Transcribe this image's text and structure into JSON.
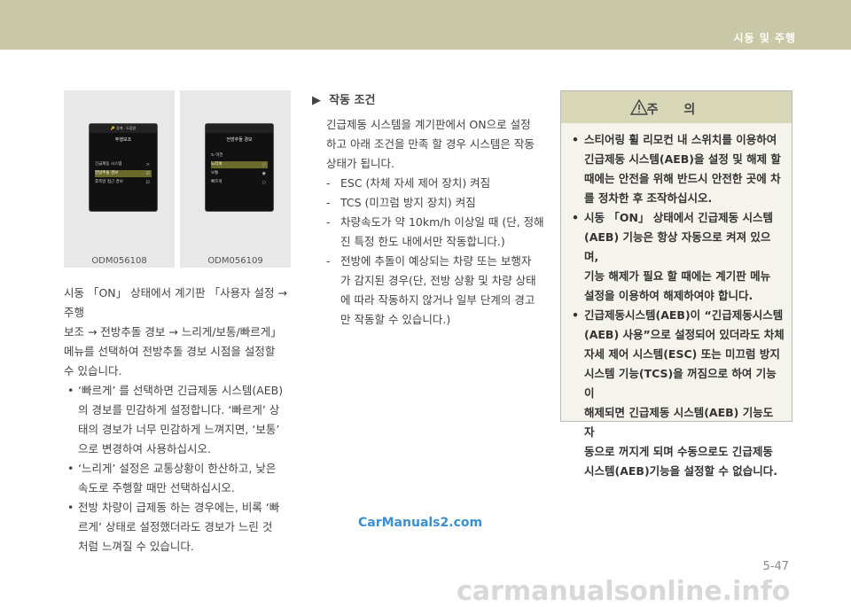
{
  "header": {
    "title": "시동 및 주행"
  },
  "page_number": "5-47",
  "images": [
    {
      "caption": "ODM056108",
      "screen_top": "🔑 경계 · 도움말",
      "screen_title": "주행보조",
      "rows": [
        "긴급제동 시스템",
        "전방추돌 경보",
        "후측방 접근 경보"
      ],
      "marks": [
        ">",
        "☑",
        "☑"
      ]
    },
    {
      "caption": "ODM056109",
      "screen_top": "",
      "screen_title": "전방추돌 경보",
      "rows": [
        "↻ 이전",
        "느리게",
        "보통",
        "빠르게"
      ],
      "marks": [
        "",
        "○",
        "◉",
        "○"
      ]
    }
  ],
  "left_text": {
    "intro": [
      "시동 「ON」 상태에서 계기판 「사용자 설정 →주행",
      "보조 → 전방추돌 경보 → 느리게/보통/빠르게」",
      "메뉴를 선택하여 전방추돌 경보 시점을 설정할",
      "수 있습니다."
    ],
    "bullets": [
      [
        "‘빠르게’ 를 선택하면 긴급제동 시스템(AEB)",
        "의 경보를 민감하게 설정합니다. ‘빠르게’ 상",
        "태의 경보가 너무 민감하게 느껴지면, ‘보통’",
        "으로 변경하여 사용하십시오."
      ],
      [
        "‘느리게’ 설정은 교통상황이 한산하고, 낮은",
        "속도로 주행할 때만 선택하십시오."
      ],
      [
        "전방 차량이 급제동 하는 경우에는, 비록 ‘빠",
        "르게’ 상태로 설정했더라도 경보가 느린 것",
        "처럼 느껴질 수 있습니다."
      ]
    ]
  },
  "section": {
    "arrow": "▶",
    "title": "작동 조건",
    "intro": [
      "긴급제동 시스템을 계기판에서 ON으로 설정",
      "하고 아래 조건을 만족 할 경우 시스템은 작동",
      "상태가 됩니다."
    ],
    "items": [
      [
        "ESC (차체 자세 제어 장치) 켜짐"
      ],
      [
        "TCS (미끄럼 방지 장치) 켜짐"
      ],
      [
        "차량속도가 약 10km/h 이상일 때 (단, 정해",
        "진 특정 한도 내에서만 작동합니다.)"
      ],
      [
        "전방에 추돌이 예상되는 차량 또는 보행자",
        "가 감지된 경우(단, 전방 상황 및 차량 상태",
        "에 따라 작동하지 않거나 일부 단계의 경고",
        "만 작동할 수 있습니다.)"
      ]
    ]
  },
  "caution": {
    "title": "주 의",
    "bullets": [
      [
        "스티어링 휠 리모컨 내 스위치를 이용하여",
        "긴급제동 시스템(AEB)을 설정 및 해제 할",
        "때에는 안전을 위해 반드시 안전한 곳에 차",
        "를 정차한 후 조작하십시오."
      ],
      [
        "시동 「ON」 상태에서 긴급제동 시스템",
        "(AEB) 기능은 항상 자동으로 켜져 있으며,",
        "기능 해제가 필요 할 때에는 계기판 메뉴",
        "설정을 이용하여 해제하여야 합니다."
      ],
      [
        "긴급제동시스템(AEB)이 “긴급제동시스템",
        "(AEB) 사용”으로 설정되어 있더라도 차체",
        "자세 제어 시스템(ESC) 또는 미끄럼 방지",
        "시스템 기능(TCS)을 꺼짐으로 하여 기능이",
        "해제되면 긴급제동 시스템(AEB) 기능도 자",
        "동으로 꺼지게 되며 수동으로도 긴급제동",
        "시스템(AEB)기능을 설정할 수 없습니다."
      ]
    ]
  },
  "watermarks": {
    "primary": "CarManuals2.com",
    "secondary": "carmanualsonline.info"
  }
}
